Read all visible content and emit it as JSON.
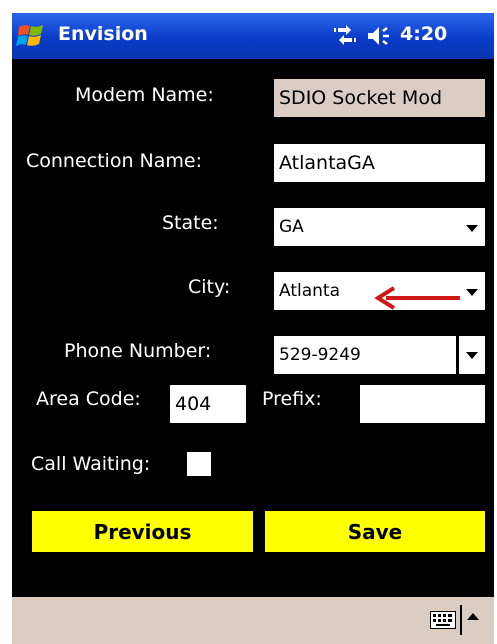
{
  "titlebar": {
    "app_title": "Envision",
    "time": "4:20"
  },
  "form": {
    "modem_name_label": "Modem Name:",
    "modem_name_value": "SDIO Socket Mod",
    "connection_name_label": "Connection Name:",
    "connection_name_value": "AtlantaGA",
    "state_label": "State:",
    "state_value": "GA",
    "city_label": "City:",
    "city_value": "Atlanta",
    "phone_label": "Phone Number:",
    "phone_value": "529-9249",
    "area_code_label": "Area Code:",
    "area_code_value": "404",
    "prefix_label": "Prefix:",
    "prefix_value": "",
    "call_waiting_label": "Call Waiting:",
    "call_waiting_checked": false
  },
  "buttons": {
    "previous": "Previous",
    "save": "Save"
  },
  "colors": {
    "titlebar": "#0a3cc9",
    "background": "#000000",
    "button": "#ffff00",
    "readonly_field": "#dccdc4",
    "annotation_arrow": "#d01818"
  },
  "icons": [
    "windows-start-icon",
    "sync-icon",
    "speaker-icon",
    "keyboard-icon",
    "arrow-up-icon"
  ]
}
